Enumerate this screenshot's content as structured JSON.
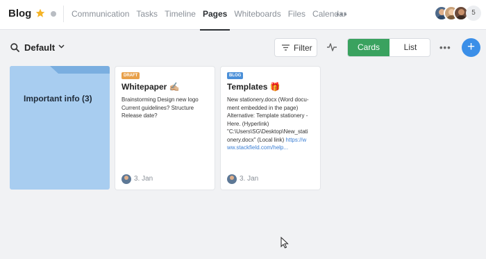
{
  "header": {
    "title": "Blog",
    "nav": [
      "Communication",
      "Tasks",
      "Timeline",
      "Pages",
      "Whiteboards",
      "Files",
      "Calendar"
    ],
    "active_nav": "Pages",
    "more": "•••",
    "member_count": "5"
  },
  "toolbar": {
    "view_name": "Default",
    "filter_label": "Filter",
    "cards_label": "Cards",
    "list_label": "List",
    "more": "•••",
    "add": "+"
  },
  "colors": {
    "accent_green": "#3aa25f",
    "accent_blue": "#3b8fe8",
    "folder": "#a8cdf0",
    "draft_badge": "#e8a04a",
    "blog_badge": "#4a8fd8"
  },
  "folder": {
    "title": "Important info (3)"
  },
  "cards": [
    {
      "badge": "DRAFT",
      "title": "Whitepaper",
      "emoji": "✍🏼",
      "lines": [
        "Brainstorming Design new logo",
        "Current guidelines? Structure",
        "Release date?"
      ],
      "date": "3. Jan"
    },
    {
      "badge": "BLOG",
      "title": "Templates",
      "emoji": "🎁",
      "lines": [
        "New stationery.docx (Word docu-",
        "ment embedded in the page)",
        "Alternative: Template stationery -",
        "Here. (Hyperlink)",
        "\"C:\\Users\\SG\\Desktop\\New_stati",
        "onery.docx\" (Local link) "
      ],
      "link": [
        "https://w",
        "ww.stackfield.com/help..."
      ],
      "date": "3. Jan"
    }
  ]
}
